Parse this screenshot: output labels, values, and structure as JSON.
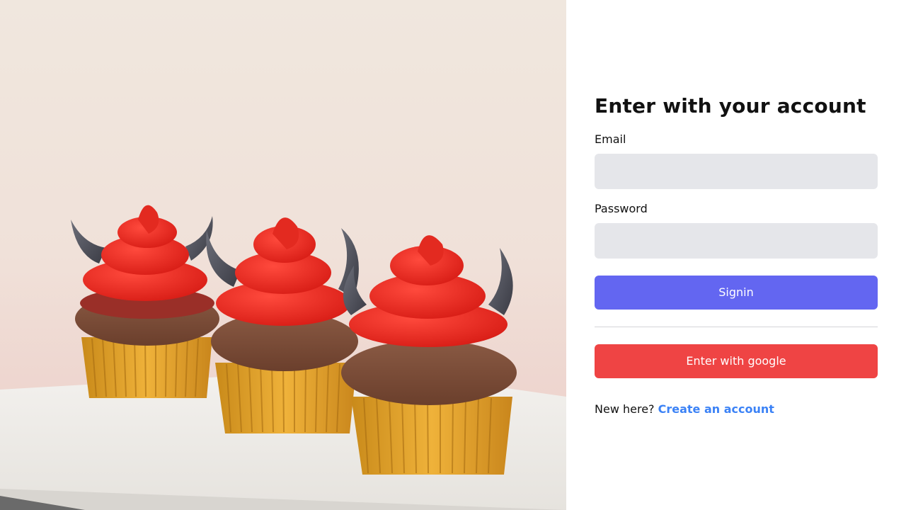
{
  "login": {
    "title": "Enter with your account",
    "email_label": "Email",
    "email_value": "",
    "password_label": "Password",
    "password_value": "",
    "signin_label": "Signin",
    "google_label": "Enter with google",
    "signup_prompt": "New here?",
    "signup_link": "Create an account"
  },
  "colors": {
    "primary": "#6366f1",
    "google": "#ef4444",
    "link": "#3b82f6",
    "input_bg": "#e5e6ea"
  }
}
